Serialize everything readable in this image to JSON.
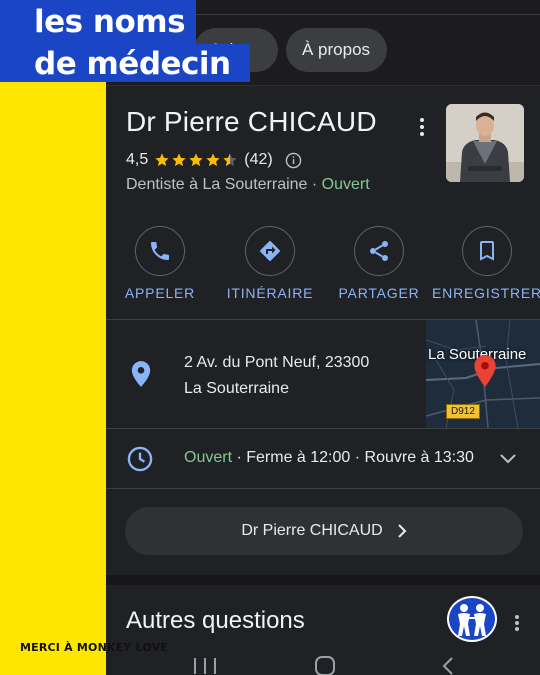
{
  "caption": {
    "line1": "les noms",
    "line2": "de médecin"
  },
  "credit": "MERCI À MONKEY LOVE",
  "tabs": {
    "reviews_label": "Avis",
    "about_label": "À propos"
  },
  "place": {
    "name": "Dr Pierre CHICAUD",
    "rating": "4,5",
    "stars": 4.5,
    "review_count": "(42)",
    "category": "Dentiste à La Souterraine",
    "separator": " · ",
    "status": "Ouvert"
  },
  "actions": [
    {
      "label": "APPELER",
      "icon": "phone-icon"
    },
    {
      "label": "ITINÉRAIRE",
      "icon": "directions-icon"
    },
    {
      "label": "PARTAGER",
      "icon": "share-icon"
    },
    {
      "label": "ENREGISTRER",
      "icon": "bookmark-icon"
    }
  ],
  "address": {
    "line1": "2 Av. du Pont Neuf, 23300",
    "line2": "La Souterraine"
  },
  "map": {
    "label": "La Souterraine",
    "road": "D912"
  },
  "hours": {
    "status": "Ouvert",
    "detail": " · Ferme à 12:00 · Rouvre à 13:30"
  },
  "profile_chip": {
    "label": "Dr Pierre CHICAUD"
  },
  "section": {
    "title": "Autres questions"
  },
  "colors": {
    "accent_blue": "#8ab4f8",
    "open_green": "#81c995",
    "star_gold": "#fbbc04",
    "band_yellow": "#ffe600",
    "caption_blue": "#1a46c6"
  }
}
